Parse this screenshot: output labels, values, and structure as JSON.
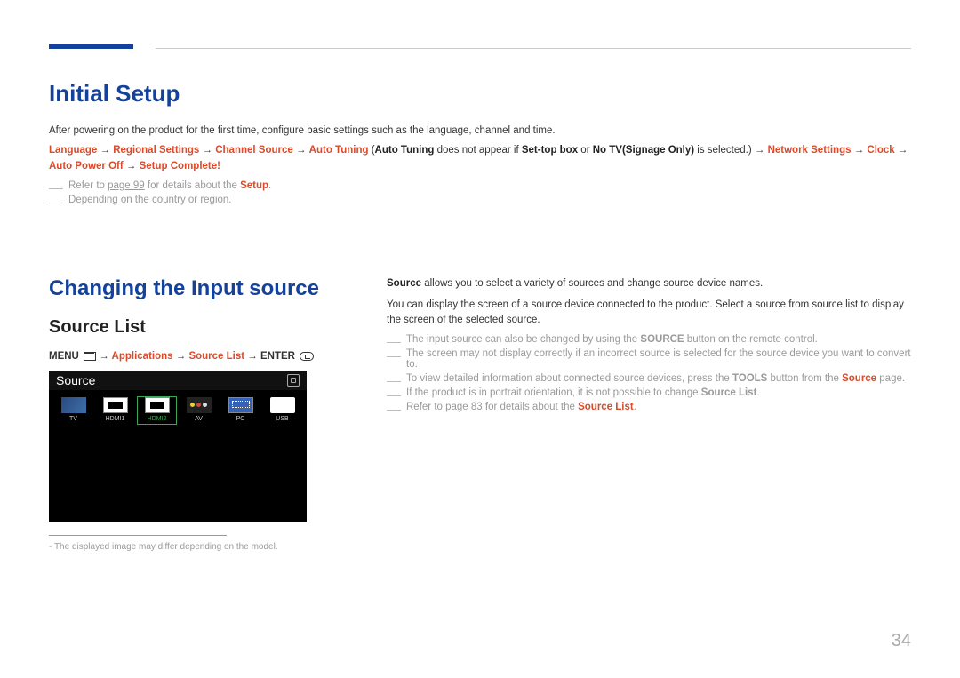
{
  "page_number": "34",
  "section1": {
    "title": "Initial Setup",
    "intro": "After powering on the product for the first time, configure basic settings such as the language, channel and time.",
    "flow": {
      "p1": "Language",
      "p2": "Regional Settings",
      "p3": "Channel Source",
      "p4": "Auto Tuning",
      "p5a": "Auto Tuning",
      "mid1": " does not appear if ",
      "p5b": "Set-top box",
      "mid2": " or ",
      "p5c": "No TV(Signage Only)",
      "mid3": " is selected.) → ",
      "p6": "Network Settings",
      "p7": "Clock",
      "p8": "Auto Power Off",
      "p9": "Setup Complete!"
    },
    "note1_pre": "Refer to ",
    "note1_link": "page 99",
    "note1_mid": " for details about the ",
    "note1_bold": "Setup",
    "note1_end": ".",
    "note2": "Depending on the country or region."
  },
  "section2": {
    "title": "Changing the Input source",
    "subtitle": "Source List",
    "menupath": {
      "menu": "MENU",
      "applications": "Applications",
      "sourcelist": "Source List",
      "enter": "ENTER"
    },
    "screenshot": {
      "header": "Source",
      "items": [
        "TV",
        "HDMI1",
        "HDMI2",
        "AV",
        "PC",
        "USB"
      ],
      "selected_index": 2
    },
    "footnote_dash": "-",
    "footnote": "The displayed image may differ depending on the model.",
    "right": {
      "p1_bold": "Source",
      "p1_rest": " allows you to select a variety of sources and change source device names.",
      "p2": "You can display the screen of a source device connected to the product. Select a source from source list to display the screen of the selected source.",
      "n1_pre": "The input source can also be changed by using the ",
      "n1_bold": "SOURCE",
      "n1_post": " button on the remote control.",
      "n2": "The screen may not display correctly if an incorrect source is selected for the source device you want to convert to.",
      "n3_pre": "To view detailed information about connected source devices, press the ",
      "n3_bold": "TOOLS",
      "n3_mid": " button from the ",
      "n3_red": "Source",
      "n3_post": " page.",
      "n4_pre": "If the product is in portrait orientation, it is not possible to change ",
      "n4_bold": "Source List",
      "n4_post": ".",
      "n5_pre": "Refer to ",
      "n5_link": "page 83",
      "n5_mid": " for details about the ",
      "n5_red": "Source List",
      "n5_post": "."
    }
  }
}
